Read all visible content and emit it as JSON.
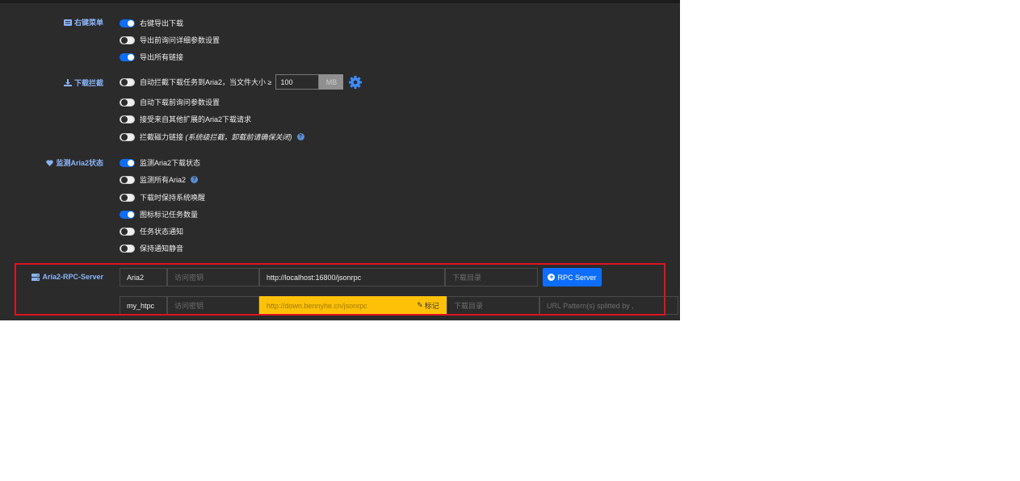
{
  "sections": {
    "context_menu": {
      "icon": "menu-icon",
      "label": "右键菜单"
    },
    "download_intercept": {
      "icon": "download-icon",
      "label": "下载拦截"
    },
    "monitor": {
      "icon": "heart-icon",
      "label": "监测Aria2状态"
    },
    "rpc": {
      "icon": "server-icon",
      "label": "Aria2-RPC-Server"
    }
  },
  "context_menu_options": [
    {
      "label": "右键导出下载",
      "on": true
    },
    {
      "label": "导出前询问详细参数设置",
      "on": false
    },
    {
      "label": "导出所有链接",
      "on": true
    }
  ],
  "download_options": {
    "intercept": {
      "label": "自动拦截下载任务到Aria2，当文件大小 ≥",
      "on": false,
      "size_value": "100",
      "unit": "MB"
    },
    "ask_before": {
      "label": "自动下载前询问参数设置",
      "on": false
    },
    "accept_external": {
      "label": "接受来自其他扩展的Aria2下载请求",
      "on": false
    },
    "magnet": {
      "label": "拦截磁力链接",
      "note": "(系统级拦截，卸载前请确保关闭)",
      "on": false
    }
  },
  "monitor_options": [
    {
      "label": "监测Aria2下载状态",
      "on": true,
      "help": false
    },
    {
      "label": "监测所有Aria2",
      "on": false,
      "help": true
    },
    {
      "label": "下载时保持系统唤醒",
      "on": false,
      "help": false
    },
    {
      "label": "图标标记任务数量",
      "on": true,
      "help": false
    },
    {
      "label": "任务状态通知",
      "on": false,
      "help": false
    },
    {
      "label": "保持通知静音",
      "on": false,
      "help": false
    }
  ],
  "rpc_servers": [
    {
      "name": "Aria2",
      "secret_placeholder": "访问密钥",
      "url": "http://localhost:16800/jsonrpc",
      "dir_placeholder": "下载目录",
      "button": "RPC Server"
    },
    {
      "name": "my_htpc",
      "secret_placeholder": "访问密钥",
      "url_placeholder": "http://down.bennyhe.cn/jsonrpc",
      "mark": "标记",
      "dir_placeholder": "下载目录",
      "pattern_placeholder": "URL Pattern(s) splitted by ,"
    }
  ],
  "colors": {
    "accent": "#0d6efd",
    "highlight": "#ffc107",
    "panel_bg": "#2b2b2b",
    "label": "#8ab4f8",
    "annotation": "#e0121f"
  }
}
